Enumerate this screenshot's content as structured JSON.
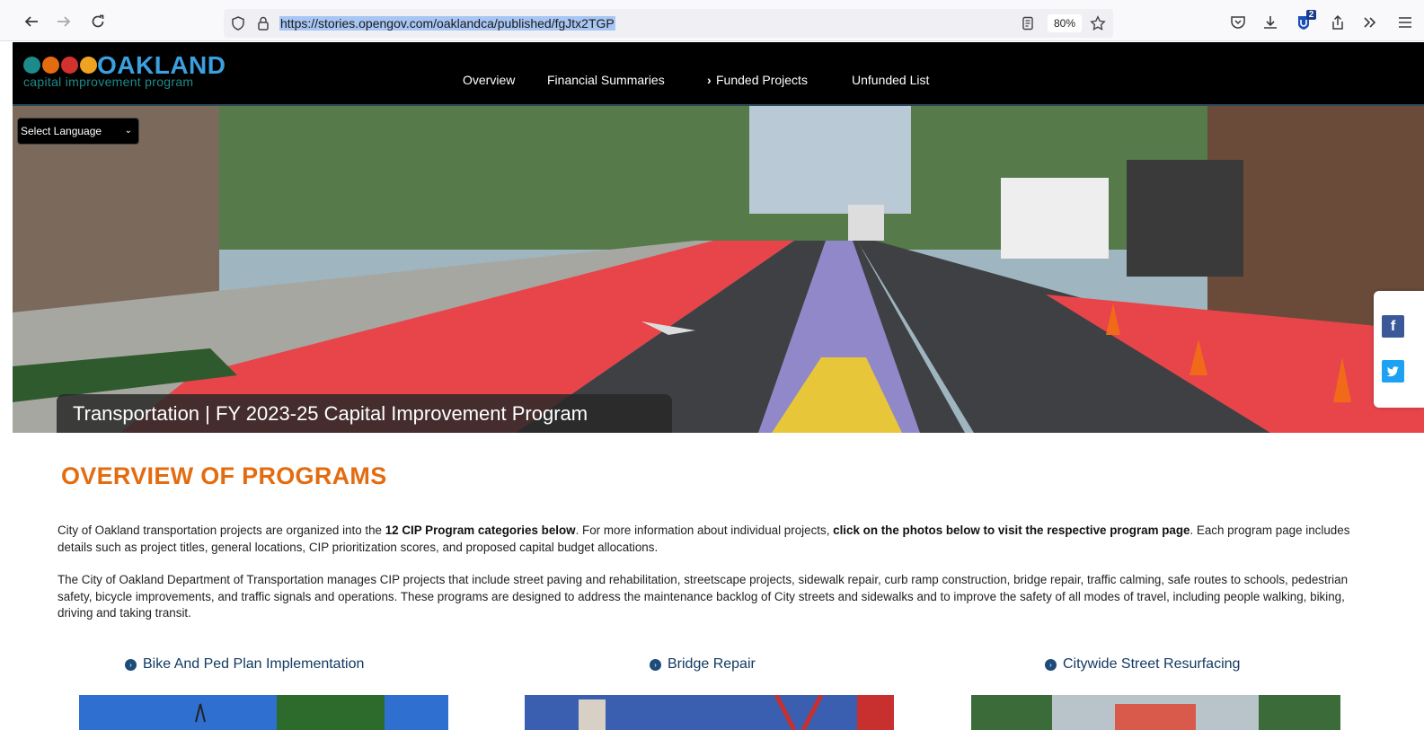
{
  "browser": {
    "url": "https://stories.opengov.com/oaklandca/published/fgJtx2TGP",
    "zoom": "80%",
    "extension_badge": "2",
    "icons": [
      "back-arrow-icon",
      "forward-arrow-icon",
      "reload-icon",
      "shield-icon",
      "lock-icon",
      "reader-view-icon",
      "star-icon",
      "pocket-icon",
      "download-icon",
      "extension-icon",
      "share-icon",
      "overflow-chevrons-icon",
      "menu-icon"
    ]
  },
  "site": {
    "logo_word": "OAKLAND",
    "logo_sub": "capital improvement program",
    "logo_colors": [
      "#1e8a8a",
      "#e46c10",
      "#d2322d",
      "#f0a320"
    ],
    "nav": [
      {
        "label": "Overview"
      },
      {
        "label": "Financial Summaries"
      },
      {
        "label": "Funded Projects",
        "has_chevron": true
      },
      {
        "label": "Unfunded List"
      }
    ]
  },
  "hero": {
    "language_select": "Select Language",
    "caption": "Transportation | FY 2023-25 Capital Improvement Program"
  },
  "social": [
    {
      "name": "facebook",
      "glyph": "f",
      "color": "#3b5998"
    },
    {
      "name": "twitter",
      "glyph": "t",
      "color": "#1da1f2"
    }
  ],
  "content": {
    "title": "OVERVIEW OF PROGRAMS",
    "p1_a": "City of Oakland transportation projects are organized into the ",
    "p1_b": "12 CIP Program categories below",
    "p1_c": ". For more information about individual projects, ",
    "p1_d": "click on the photos below to visit the respective program page",
    "p1_e": ". Each program page includes details such as project titles, general locations, CIP prioritization scores, and proposed capital budget allocations.",
    "p2": "The City of Oakland Department of Transportation manages CIP projects that include street paving and rehabilitation, streetscape projects, sidewalk repair, curb ramp construction, bridge repair, traffic calming, safe routes to schools, pedestrian safety, bicycle improvements, and traffic signals and operations. These programs are designed to address the maintenance backlog of City streets and sidewalks and to improve the safety of all modes of travel, including people walking, biking, driving and taking transit.",
    "programs": [
      {
        "label": "Bike And Ped Plan Implementation"
      },
      {
        "label": "Bridge Repair"
      },
      {
        "label": "Citywide Street Resurfacing"
      }
    ]
  },
  "colors": {
    "accent_orange": "#e46c10",
    "program_link": "#123a62",
    "header_bg": "#000000"
  }
}
